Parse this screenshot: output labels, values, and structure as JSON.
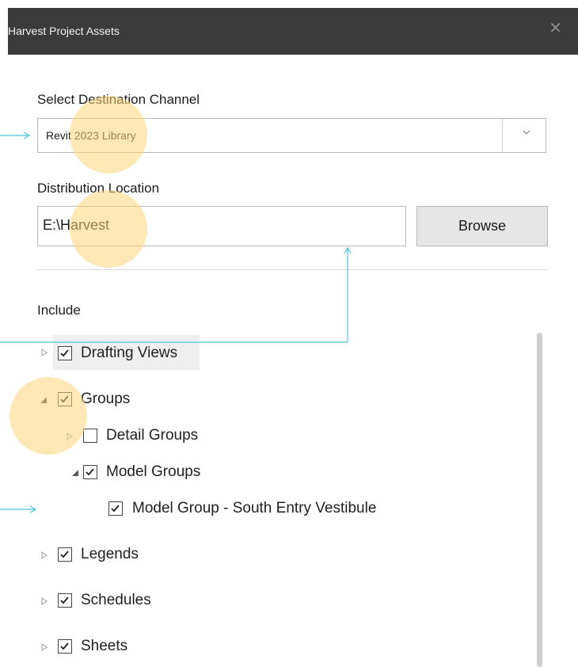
{
  "window": {
    "title": "Harvest Project Assets",
    "close_glyph": "✕"
  },
  "destination": {
    "label": "Select Destination Channel",
    "selected": "Revit 2023 Library",
    "chevron_icon": "chevron-down-icon"
  },
  "location": {
    "label": "Distribution Location",
    "value": "E:\\Harvest",
    "browse_label": "Browse"
  },
  "include": {
    "label": "Include",
    "tree": [
      {
        "label": "Drafting Views",
        "checked": true,
        "expanded": false
      },
      {
        "label": "Groups",
        "checked": true,
        "expanded": true
      },
      {
        "label": "Detail Groups",
        "checked": false,
        "expanded": false
      },
      {
        "label": "Model Groups",
        "checked": true,
        "expanded": true
      },
      {
        "label": "Model Group - South Entry Vestibule",
        "checked": true
      },
      {
        "label": "Legends",
        "checked": true,
        "expanded": false
      },
      {
        "label": "Schedules",
        "checked": true,
        "expanded": false
      },
      {
        "label": "Sheets",
        "checked": true,
        "expanded": false
      }
    ]
  },
  "colors": {
    "titlebar": "#3b3b3b",
    "annotation_line": "#4fc3d9",
    "highlight_circle": "#fdd678"
  }
}
